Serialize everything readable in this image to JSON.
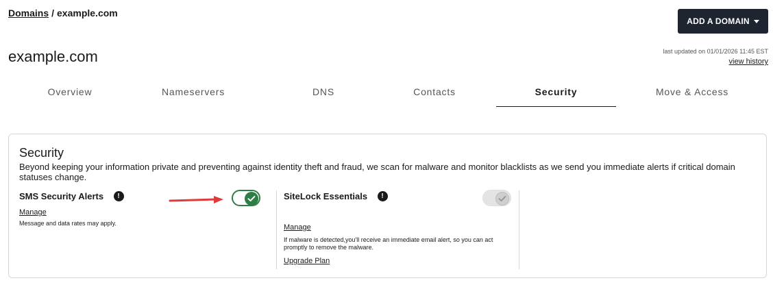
{
  "breadcrumb": {
    "root": "Domains",
    "separator": "/",
    "current": "example.com"
  },
  "header": {
    "add_domain_label": "ADD A DOMAIN",
    "title": "example.com",
    "last_updated": "last updated on 01/01/2026 11:45 EST",
    "view_history": "view history"
  },
  "tabs": [
    {
      "label": "Overview",
      "active": false
    },
    {
      "label": "Nameservers",
      "active": false
    },
    {
      "label": "DNS",
      "active": false
    },
    {
      "label": "Contacts",
      "active": false
    },
    {
      "label": "Security",
      "active": true
    },
    {
      "label": "Move & Access",
      "active": false
    }
  ],
  "security": {
    "title": "Security",
    "description": "Beyond keeping your information private and preventing against identity theft and fraud, we scan for malware and monitor blacklists as we send you immediate alerts if critical domain statuses change.",
    "sms": {
      "name": "SMS Security Alerts",
      "info": "!",
      "manage": "Manage",
      "note": "Message and data rates may apply.",
      "enabled": true
    },
    "sitelock": {
      "name": "SiteLock Essentials",
      "info": "!",
      "manage": "Manage",
      "note": "If malware is detected,you'll receive an immediate email alert, so you can act promptly to remove the malware.",
      "upgrade": "Upgrade Plan",
      "enabled": false
    }
  },
  "colors": {
    "button_bg": "#1e2430",
    "toggle_on": "#2e7d45",
    "arrow": "#e03a3a"
  }
}
